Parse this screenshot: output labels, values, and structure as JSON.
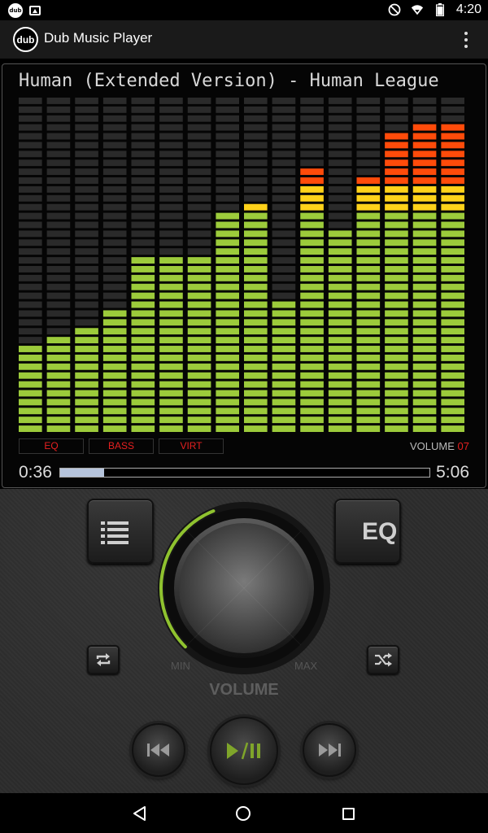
{
  "status_bar": {
    "time": "4:20",
    "left_icons": [
      "dub-app-notification-icon",
      "image-notification-icon"
    ],
    "right_icons": [
      "do-not-disturb-icon",
      "wifi-icon",
      "battery-icon"
    ],
    "dub_mini_text": "dub"
  },
  "app_bar": {
    "logo_text": "dub",
    "title": "Dub Music Player",
    "menu_icon": "overflow-menu-icon"
  },
  "player": {
    "song_title": "Human (Extended Version) - Human League",
    "tags": [
      "EQ",
      "BASS",
      "VIRT"
    ],
    "volume_label": "VOLUME",
    "volume_value": "07",
    "current_time": "0:36",
    "total_time": "5:06",
    "progress": 0.12
  },
  "spectrum": {
    "segments_per_bar": 38,
    "lit_segments": [
      10,
      11,
      12,
      14,
      20,
      20,
      20,
      25,
      26,
      15,
      30,
      23,
      29,
      34,
      35,
      35
    ],
    "colors": {
      "unlit": "#2a2a2a",
      "green": "#9ccb3b",
      "yellow": "#ffd21a",
      "red": "#ff4b0a"
    },
    "green_max": 25,
    "yellow_max": 28
  },
  "controls": {
    "playlist_icon": "playlist-icon",
    "eq_label": "EQ",
    "repeat_icon": "repeat-icon",
    "shuffle_icon": "shuffle-icon",
    "knob": {
      "min_label": "MIN",
      "max_label": "MAX",
      "label": "VOLUME",
      "level": 0.42,
      "accent": "#8fc22f"
    },
    "prev_icon": "skip-previous-icon",
    "play_icon": "play-pause-icon",
    "next_icon": "skip-next-icon"
  },
  "nav_bar": {
    "icons": [
      "back-icon",
      "home-icon",
      "recents-icon"
    ]
  }
}
